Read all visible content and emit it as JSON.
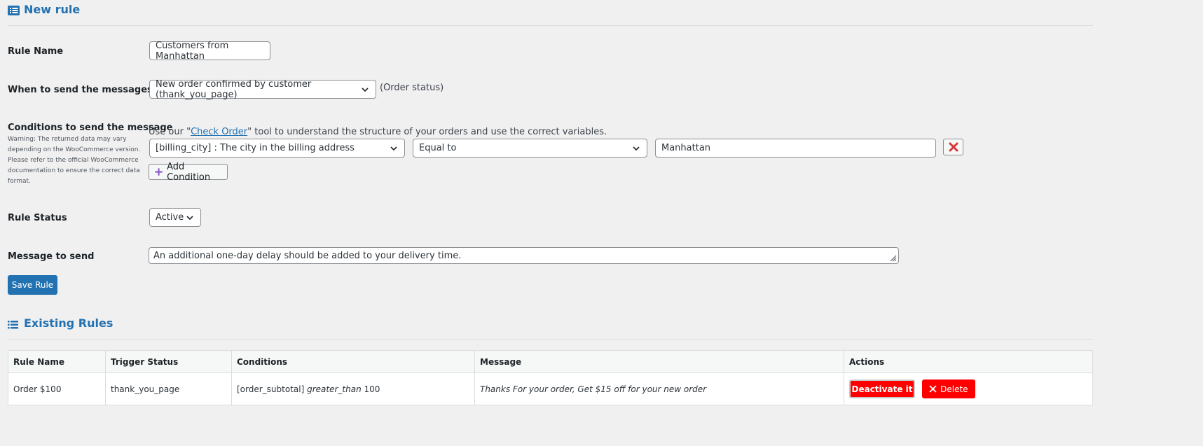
{
  "new_rule_title": "New rule",
  "existing_rules_title": "Existing Rules",
  "form": {
    "rule_name_label": "Rule Name",
    "rule_name_value": "Customers from Manhattan",
    "when_label": "When to send the messages ?",
    "when_value": "New order confirmed by customer (thank_you_page)",
    "when_hint": "(Order status)",
    "conditions_label": "Conditions to send the message",
    "conditions_warning": "Warning: The returned data may vary depending on the WooCommerce version. Please refer to the official WooCommerce documentation to ensure the correct data format.",
    "check_order_prefix": "Use our \"",
    "check_order_link": "Check Order",
    "check_order_suffix": "\" tool to understand the structure of your orders and use the correct variables.",
    "condition_field": "[billing_city] : The city in the billing address",
    "condition_operator": "Equal to",
    "condition_value": "Manhattan",
    "add_condition_label": "Add Condition",
    "status_label": "Rule Status",
    "status_value": "Active",
    "message_label": "Message to send",
    "message_value": "An additional one-day delay should be added to your delivery time.",
    "save_label": "Save Rule"
  },
  "table": {
    "headers": [
      "Rule Name",
      "Trigger Status",
      "Conditions",
      "Message",
      "Actions"
    ],
    "rows": [
      {
        "name": "Order $100",
        "trigger": "thank_you_page",
        "cond_field": "[order_subtotal]",
        "cond_op": "greater_than",
        "cond_value": "100",
        "message": "Thanks For your order, Get $15 off for your new order",
        "deactivate_label": "Deactivate it",
        "delete_label": "Delete"
      }
    ]
  },
  "colors": {
    "accent": "#2271b1",
    "danger": "#ff0000",
    "remove": "#d63638",
    "add_icon": "#8c5fc7"
  },
  "icons": [
    "list-icon",
    "chevron-down-icon",
    "close-icon",
    "plus-icon",
    "resize-handle-icon"
  ]
}
